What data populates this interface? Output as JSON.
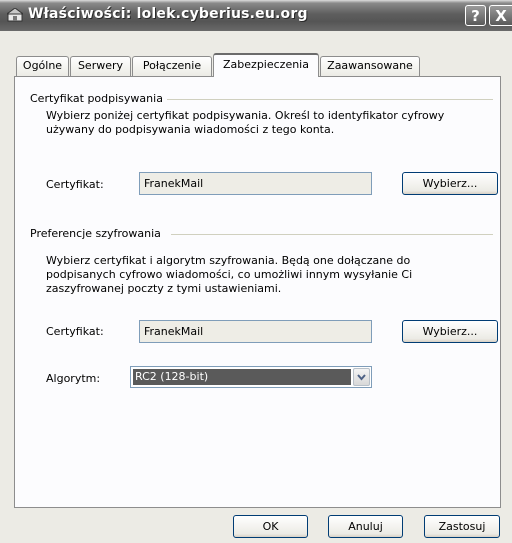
{
  "window": {
    "title": "Właściwości: lolek.cyberius.eu.org",
    "help_label": "?",
    "close_label": "X"
  },
  "tabs": [
    {
      "label": "Ogólne",
      "active": false
    },
    {
      "label": "Serwery",
      "active": false
    },
    {
      "label": "Połączenie",
      "active": false
    },
    {
      "label": "Zabezpieczenia",
      "active": true
    },
    {
      "label": "Zaawansowane",
      "active": false
    }
  ],
  "signing": {
    "group_label": "Certyfikat podpisywania",
    "description": "Wybierz poniżej certyfikat podpisywania. Określ to identyfikator cyfrowy używany do podpisywania wiadomości z tego konta.",
    "cert_label": "Certyfikat:",
    "cert_value": "FranekMail",
    "choose_label": "Wybierz..."
  },
  "encryption": {
    "group_label": "Preferencje szyfrowania",
    "description": "Wybierz certyfikat i algorytm szyfrowania. Będą one dołączane do podpisanych cyfrowo wiadomości, co umożliwi innym wysyłanie Ci zaszyfrowanej poczty z tymi ustawieniami.",
    "cert_label": "Certyfikat:",
    "cert_value": "FranekMail",
    "choose_label": "Wybierz...",
    "algorithm_label": "Algorytm:",
    "algorithm_value": "RC2 (128-bit)"
  },
  "footer": {
    "ok_label": "OK",
    "cancel_label": "Anuluj",
    "apply_label": "Zastosuj"
  }
}
